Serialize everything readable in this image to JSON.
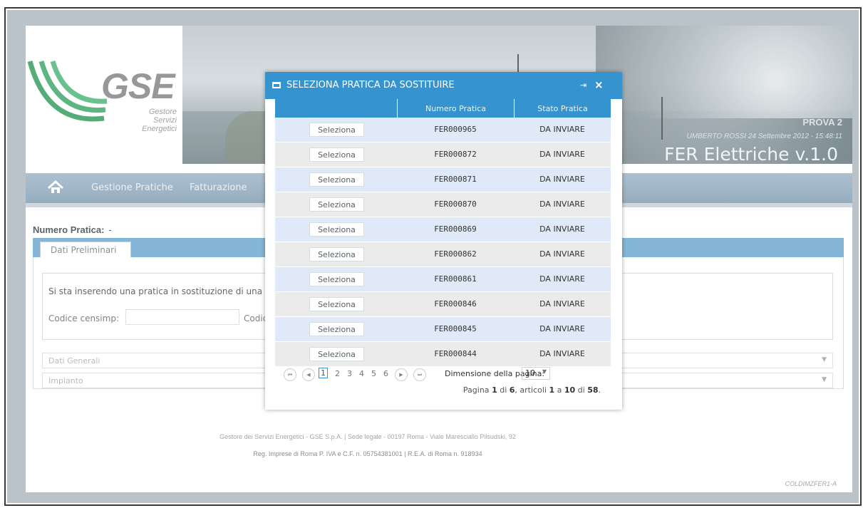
{
  "header": {
    "logo_text": "GSE",
    "logo_sub1": "Gestore",
    "logo_sub2": "Servizi",
    "logo_sub3": "Energetici",
    "environment": "PROVA 2",
    "user_info": "UMBERTO ROSSI 24 Settembre 2012 - 15:48:11",
    "app_title": "FER Elettriche  v.1.0"
  },
  "nav": {
    "items": [
      "Gestione Pratiche",
      "Fatturazione"
    ]
  },
  "content": {
    "numero_label": "Numero Pratica:",
    "numero_value": "-",
    "tab_label": "Dati Preliminari",
    "info_text": "Si sta inserendo una pratica in sostituzione di una g",
    "codice_label": "Codice censimp:",
    "codice_label2": "Codic",
    "accordion": [
      "Dati Generali",
      "Impianto"
    ]
  },
  "footer": {
    "line1": "Gestore dei Servizi Energetici - GSE S.p.A. | Sede legale - 00197 Roma - Viale Maresciallo Pilsudski, 92",
    "line2": "Reg. Imprese di Roma P. IVA e C.F. n. 05754381001 | R.E.A. di Roma n. 918934",
    "code": "COLDIMZFER1-A"
  },
  "modal": {
    "title": "SELEZIONA PRATICA DA SOSTITUIRE",
    "pin_icon": "pin-icon",
    "close_label": "×",
    "columns": [
      "",
      "Numero Pratica",
      "Stato Pratica"
    ],
    "button_label": "Seleziona",
    "rows": [
      {
        "numero": "FER000965",
        "stato": "DA INVIARE"
      },
      {
        "numero": "FER000872",
        "stato": "DA INVIARE"
      },
      {
        "numero": "FER000871",
        "stato": "DA INVIARE"
      },
      {
        "numero": "FER000870",
        "stato": "DA INVIARE"
      },
      {
        "numero": "FER000869",
        "stato": "DA INVIARE"
      },
      {
        "numero": "FER000862",
        "stato": "DA INVIARE"
      },
      {
        "numero": "FER000861",
        "stato": "DA INVIARE"
      },
      {
        "numero": "FER000846",
        "stato": "DA INVIARE"
      },
      {
        "numero": "FER000845",
        "stato": "DA INVIARE"
      },
      {
        "numero": "FER000844",
        "stato": "DA INVIARE"
      }
    ],
    "pager": {
      "pages": [
        "1",
        "2",
        "3",
        "4",
        "5",
        "6"
      ],
      "current_page": "1",
      "size_label": "Dimensione della pagina:",
      "size_value": "10",
      "info_prefix": "Pagina ",
      "info_page": "1",
      "info_of": " di ",
      "info_total_pages": "6",
      "info_items": ", articoli ",
      "info_from": "1",
      "info_a": " a ",
      "info_to": "10",
      "info_di": " di ",
      "info_total": "58",
      "info_dot": "."
    }
  },
  "colors": {
    "accent": "#3594cf",
    "nav": "#8da7bb",
    "row_odd": "#dfe9f7",
    "row_even": "#ebebeb"
  }
}
